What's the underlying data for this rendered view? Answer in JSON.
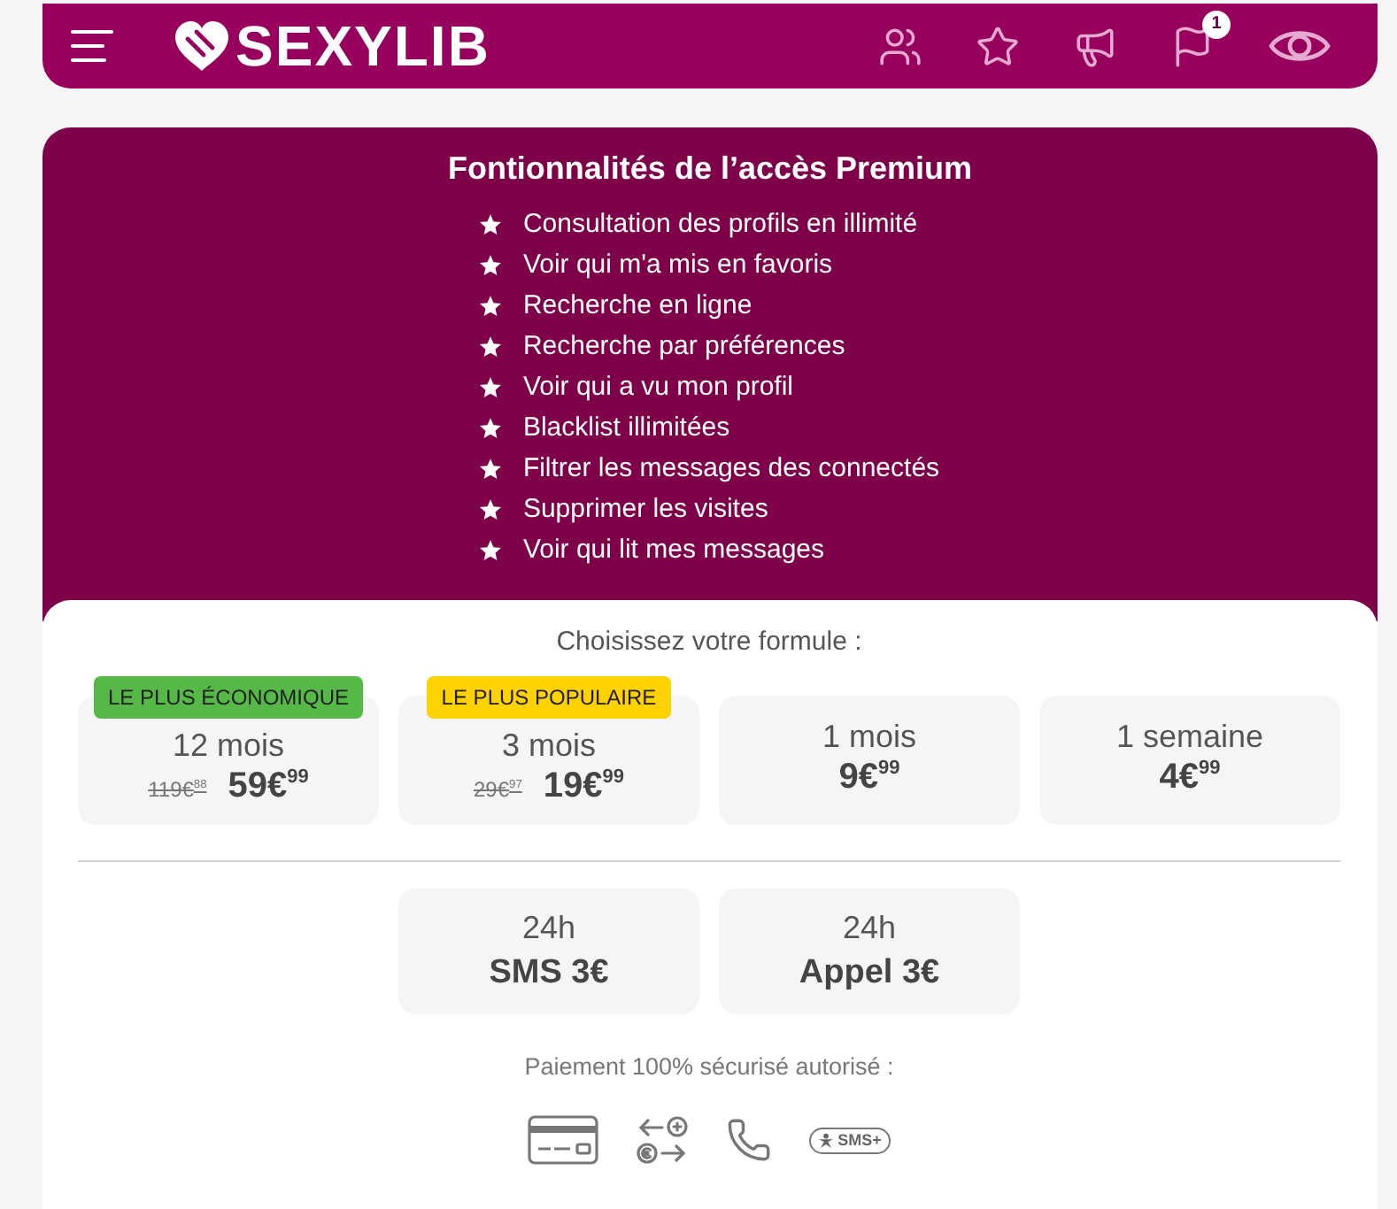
{
  "header": {
    "logo_text": "SEXYLIB",
    "notification_count": "1"
  },
  "premium": {
    "title": "Fontionnalités de l’accès Premium",
    "features": [
      "Consultation des profils en illimité",
      "Voir qui m'a mis en favoris",
      "Recherche en ligne",
      "Recherche par préférences",
      "Voir qui a vu mon profil",
      "Blacklist illimitées",
      "Filtrer les messages des connectés",
      "Supprimer les visites",
      "Voir qui lit mes messages"
    ]
  },
  "plans": {
    "prompt": "Choisissez votre formule :",
    "subscriptions": [
      {
        "duration": "12 mois",
        "old_price": "119€$^{88}$",
        "price": "59€$^{99}$",
        "badge": {
          "label": "LE PLUS ÉCONOMIQUE",
          "color": "#56b947"
        }
      },
      {
        "duration": "3 mois",
        "old_price": "29€$^{97}$",
        "price": "19€$^{99}$",
        "badge": {
          "label": "LE PLUS POPULAIRE",
          "color": "#ffd200"
        }
      },
      {
        "duration": "1 mois",
        "price": "9€$^{99}$"
      },
      {
        "duration": "1 semaine",
        "price": "4€$^{99}$"
      }
    ],
    "one_day": [
      {
        "duration": "24h",
        "price": "SMS 3€"
      },
      {
        "duration": "24h",
        "price": "Appel 3€"
      }
    ]
  },
  "payment": {
    "caption": "Paiement 100% sécurisé autorisé :",
    "methods": [
      {
        "kind": "card"
      },
      {
        "kind": "transfer"
      },
      {
        "kind": "phone"
      },
      {
        "kind": "sms",
        "label": "SMS+"
      }
    ]
  }
}
